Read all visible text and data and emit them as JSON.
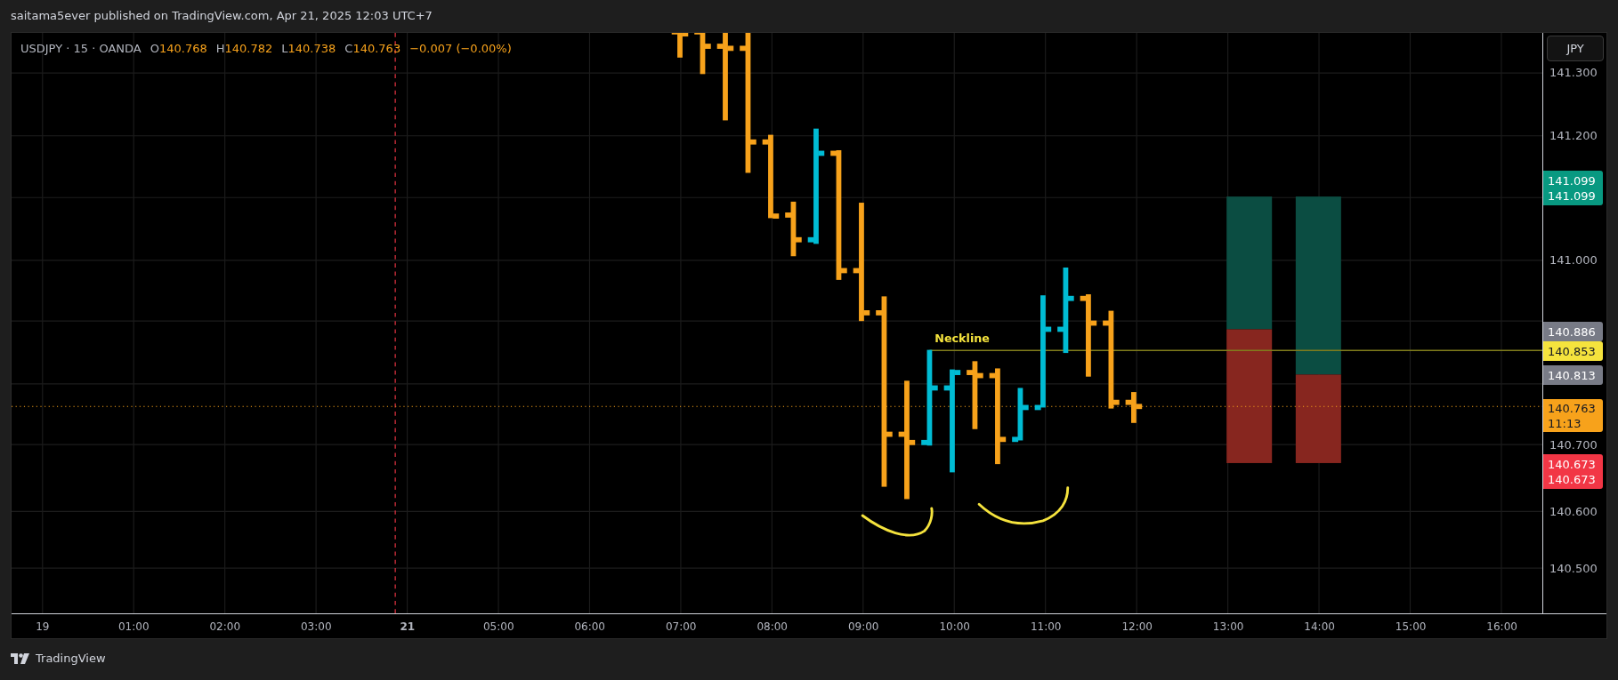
{
  "header": {
    "text": "saitama5ever published on TradingView.com, Apr 21, 2025 12:03 UTC+7"
  },
  "legend": {
    "symbol": "USDJPY · 15 · OANDA",
    "ohlc": [
      {
        "label": "O",
        "value": "140.768"
      },
      {
        "label": "H",
        "value": "140.782"
      },
      {
        "label": "L",
        "value": "140.738"
      },
      {
        "label": "C",
        "value": "140.763"
      }
    ],
    "change": "−0.007 (−0.00%)"
  },
  "annotation": {
    "text": "Neckline"
  },
  "currency_button": {
    "label": "JPY"
  },
  "price_axis": {
    "labels": [
      "141.300",
      "141.200",
      "141.000",
      "140.700",
      "140.600",
      "140.500"
    ]
  },
  "price_tags": [
    {
      "lines": [
        "141.099",
        "141.099"
      ],
      "color": "#089981"
    },
    {
      "lines": [
        "140.886"
      ],
      "color": "#787b86"
    },
    {
      "lines": [
        "140.853"
      ],
      "color": "#f5e33d"
    },
    {
      "lines": [
        "140.813"
      ],
      "color": "#787b86"
    },
    {
      "lines": [
        "140.763",
        "11:13"
      ],
      "color": "#f7a21b"
    },
    {
      "lines": [
        "140.673",
        "140.673"
      ],
      "color": "#f23645"
    }
  ],
  "time_axis": {
    "labels": [
      {
        "label": "19",
        "bold": false
      },
      {
        "label": "01:00",
        "bold": false
      },
      {
        "label": "02:00",
        "bold": false
      },
      {
        "label": "03:00",
        "bold": false
      },
      {
        "label": "21",
        "bold": true
      },
      {
        "label": "05:00",
        "bold": false
      },
      {
        "label": "06:00",
        "bold": false
      },
      {
        "label": "07:00",
        "bold": false
      },
      {
        "label": "08:00",
        "bold": false
      },
      {
        "label": "09:00",
        "bold": false
      },
      {
        "label": "10:00",
        "bold": false
      },
      {
        "label": "11:00",
        "bold": false
      },
      {
        "label": "12:00",
        "bold": false
      },
      {
        "label": "13:00",
        "bold": false
      },
      {
        "label": "14:00",
        "bold": false
      },
      {
        "label": "15:00",
        "bold": false
      },
      {
        "label": "16:00",
        "bold": false
      }
    ]
  },
  "footer": {
    "brand": "TradingView"
  }
}
